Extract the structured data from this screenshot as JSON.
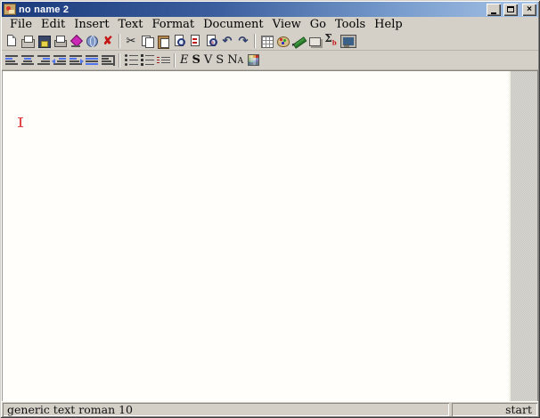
{
  "window": {
    "title": "no name 2",
    "controls": [
      "minimize",
      "maximize",
      "close"
    ],
    "glyphs": {
      "close": "×"
    }
  },
  "menubar": {
    "items": [
      "File",
      "Edit",
      "Insert",
      "Text",
      "Format",
      "Document",
      "View",
      "Go",
      "Tools",
      "Help"
    ]
  },
  "toolbar_main": {
    "file_group": [
      "new-document",
      "open-document",
      "save",
      "print",
      "export",
      "web-browse",
      "close-document"
    ],
    "edit_group": [
      "cut",
      "copy",
      "paste",
      "find",
      "replace",
      "spell-check",
      "undo",
      "redo"
    ],
    "insert_group": [
      "insert-table",
      "insert-image",
      "insert-link",
      "insert-switch",
      "insert-math",
      "insert-session"
    ],
    "glyphs": {
      "close_document": "✘",
      "cut": "✂",
      "undo": "↶",
      "redo": "↷",
      "math": "Σ"
    }
  },
  "toolbar_format": {
    "paragraph_group": [
      "align-left",
      "align-center",
      "align-right",
      "indent-left",
      "indent-right",
      "justify",
      "no-indentation"
    ],
    "list_group": [
      "itemize",
      "enumerate",
      "description"
    ],
    "style_buttons": [
      "E",
      "S",
      "V",
      "S",
      "Na"
    ],
    "style_names": [
      "emphasize",
      "strong",
      "verbatim",
      "sample",
      "name"
    ],
    "color_palette": "text-color-grid"
  },
  "document": {
    "text": "",
    "caret_visible": true
  },
  "statusbar": {
    "left": "generic text roman 10",
    "right": "start"
  },
  "colors": {
    "titlebar_start": "#1a3a7c",
    "titlebar_end": "#a8c4e6",
    "chrome": "#d4d0c8",
    "canvas": "#fffefa",
    "caret": "#e04848"
  }
}
